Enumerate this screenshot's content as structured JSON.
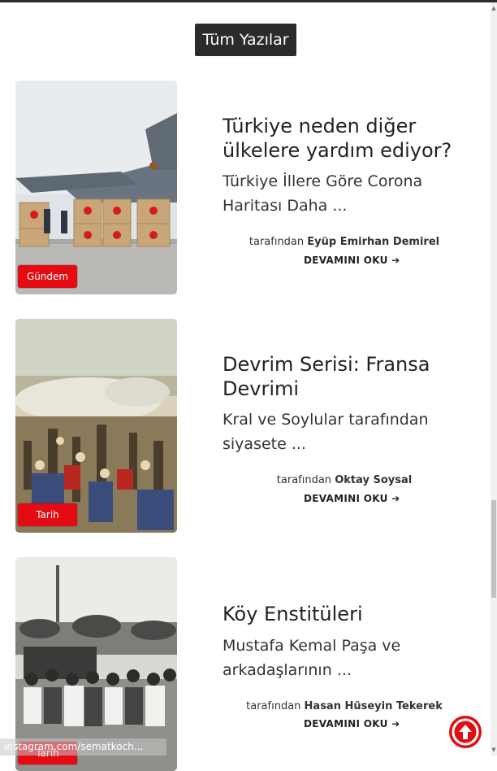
{
  "section_title": "Tüm Yazılar",
  "by_prefix": "tarafından",
  "posts": [
    {
      "title": "Türkiye neden diğer ülkelere yardım ediyor?",
      "excerpt": "Türkiye İllere Göre Corona Haritası Daha ...",
      "author": "Eyüp Emirhan Demirel",
      "category": "Gündem",
      "readmore": "DEVAMINI OKU"
    },
    {
      "title": "Devrim Serisi: Fransa Devrimi",
      "excerpt": "Kral ve Soylular tarafından siyasete ...",
      "author": "Oktay Soysal",
      "category": "Tarih",
      "readmore": "DEVAMINI OKU"
    },
    {
      "title": "Köy Enstitüleri",
      "excerpt": "Mustafa Kemal Paşa ve arkadaşlarının ...",
      "author": "Hasan Hüseyin Tekerek",
      "category": "Tarih",
      "readmore": "DEVAMINI OKU"
    }
  ],
  "watermark": "instagram.com/sematkoch...",
  "colors": {
    "badge": "#e50b13",
    "title_bg": "#2b2b2b"
  },
  "icons": {
    "readmore": "arrow-right-icon",
    "scroll_top": "arrow-up-circle-icon"
  }
}
